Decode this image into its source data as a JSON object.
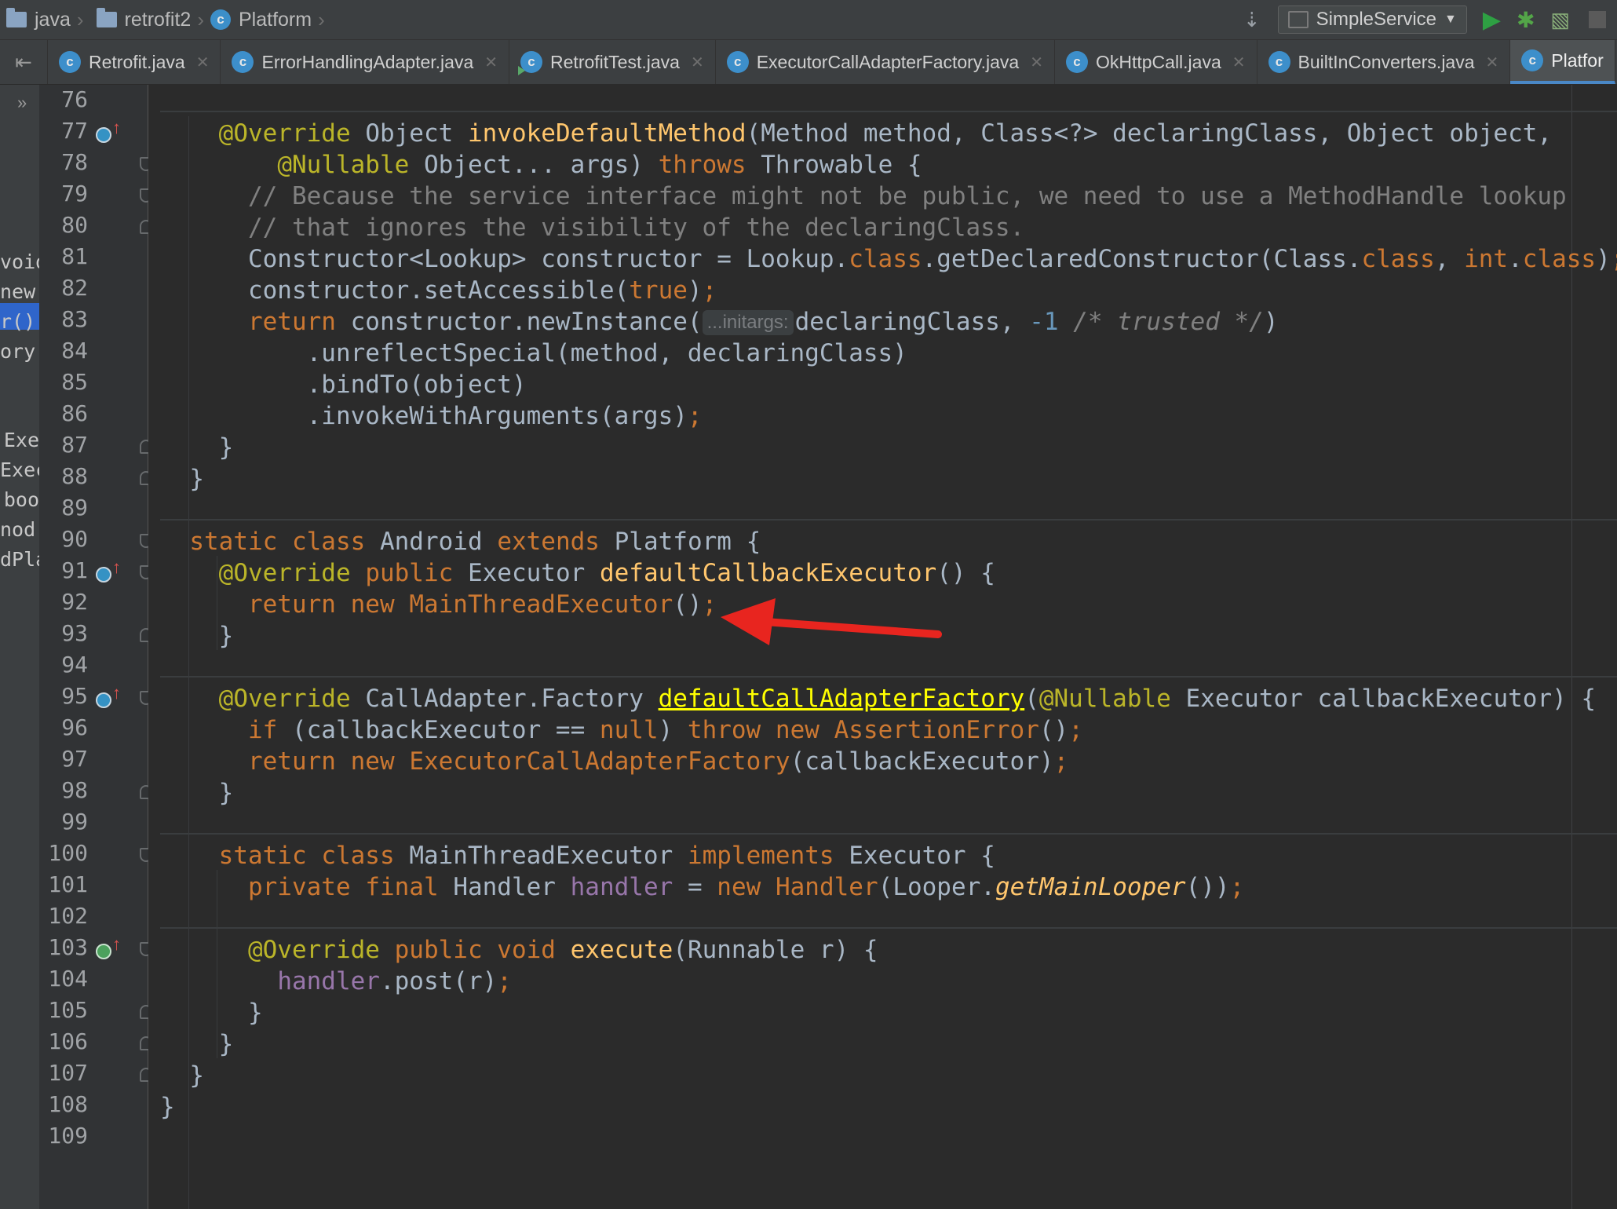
{
  "navbar": {
    "crumbs": [
      "java",
      "retrofit2",
      "Platform"
    ],
    "run_config": "SimpleService"
  },
  "tabs": [
    {
      "label": "Retrofit.java",
      "active": false
    },
    {
      "label": "ErrorHandlingAdapter.java",
      "active": false
    },
    {
      "label": "RetrofitTest.java",
      "active": false
    },
    {
      "label": "ExecutorCallAdapterFactory.java",
      "active": false
    },
    {
      "label": "OkHttpCall.java",
      "active": false
    },
    {
      "label": "BuiltInConverters.java",
      "active": false
    },
    {
      "label": "Platfor",
      "active": true
    }
  ],
  "project_peek": [
    "void",
    "new I",
    "r(): I",
    "ory(E",
    "Exe",
    "Exec",
    "boo",
    "nod,",
    "dPlat"
  ],
  "line_numbers": [
    "76",
    "77",
    "78",
    "79",
    "80",
    "81",
    "82",
    "83",
    "84",
    "85",
    "86",
    "87",
    "88",
    "89",
    "90",
    "91",
    "92",
    "93",
    "94",
    "95",
    "96",
    "97",
    "98",
    "99",
    "100",
    "101",
    "102",
    "103",
    "104",
    "105",
    "106",
    "107",
    "108",
    "109"
  ],
  "code": {
    "l77": {
      "ann": "@Override",
      "type": "Object",
      "fn": "invokeDefaultMethod",
      "params": "(Method method, Class<?> declaringClass, Object object,"
    },
    "l78": {
      "ann": "@Nullable",
      "rest": "Object... args)",
      "kw": "throws",
      "tail": "Throwable {"
    },
    "l79": "// Because the service interface might not be public, we need to use a MethodHandle lookup",
    "l80": "// that ignores the visibility of the declaringClass.",
    "l81": {
      "a": "Constructor<Lookup> constructor = Lookup.",
      "kw1": "class",
      "b": ".getDeclaredConstructor(Class.",
      "kw2": "class",
      "c": ", ",
      "kw3": "int",
      "d": ".",
      "kw4": "class",
      "e": ")",
      "semi": ";"
    },
    "l82": {
      "a": "constructor.setAccessible(",
      "kw": "true",
      "b": ")",
      "semi": ";"
    },
    "l83": {
      "kw": "return",
      "a": " constructor.newInstance(",
      "hint": "...initargs:",
      "b": "declaringClass, ",
      "num": "-1",
      "cm": " /* trusted */",
      "c": ")"
    },
    "l84": ".unreflectSpecial(method, declaringClass)",
    "l85": ".bindTo(object)",
    "l86": {
      "a": ".invokeWithArguments(args)",
      "semi": ";"
    },
    "l87": "}",
    "l88": "}",
    "l90": {
      "kw1": "static",
      "kw2": "class",
      "name": "Android",
      "kw3": "extends",
      "tail": "Platform {"
    },
    "l91": {
      "ann": "@Override",
      "kw": "public",
      "type": "Executor",
      "fn": "defaultCallbackExecutor",
      "tail": "() {"
    },
    "l92": {
      "kw1": "return",
      "kw2": "new",
      "cls": "MainThreadExecutor",
      "tail": "()",
      "semi": ";"
    },
    "l93": "}",
    "l95": {
      "ann": "@Override",
      "type": "CallAdapter.Factory",
      "fn": "defaultCallAdapterFactory",
      "ann2": "@Nullable",
      "tail": "Executor callbackExecutor) {"
    },
    "l96": {
      "kw1": "if",
      "a": " (callbackExecutor == ",
      "kw2": "null",
      "b": ") ",
      "kw3": "throw",
      "kw4": "new",
      "cls": "AssertionError",
      "c": "()",
      "semi": ";"
    },
    "l97": {
      "kw1": "return",
      "kw2": "new",
      "cls": "ExecutorCallAdapterFactory",
      "tail": "(callbackExecutor)",
      "semi": ";"
    },
    "l98": "}",
    "l100": {
      "kw1": "static",
      "kw2": "class",
      "name": "MainThreadExecutor",
      "kw3": "implements",
      "tail": "Executor {"
    },
    "l101": {
      "kw1": "private",
      "kw2": "final",
      "type": "Handler",
      "field": "handler",
      "eq": " = ",
      "kw3": "new",
      "cls": "Handler",
      "a": "(Looper.",
      "st": "getMainLooper",
      "b": "())",
      "semi": ";"
    },
    "l103": {
      "ann": "@Override",
      "kw1": "public",
      "kw2": "void",
      "fn": "execute",
      "tail": "(Runnable r) {"
    },
    "l104": {
      "field": "handler",
      "a": ".post(r)",
      "semi": ";"
    },
    "l105": "}",
    "l106": "}",
    "l107": "}",
    "l108": "}"
  },
  "colors": {
    "keyword": "#cc7832",
    "annotation": "#bbb529",
    "method_decl": "#ffc66d",
    "comment": "#808080",
    "number": "#6897bb",
    "field": "#9876aa",
    "annotation_arrow": "#e8251f"
  },
  "icons": [
    "folder-icon",
    "class-icon",
    "run-icon",
    "debug-icon",
    "coverage-icon",
    "stop-icon",
    "override-icon",
    "implements-icon",
    "fold-icon",
    "bulb-icon"
  ]
}
